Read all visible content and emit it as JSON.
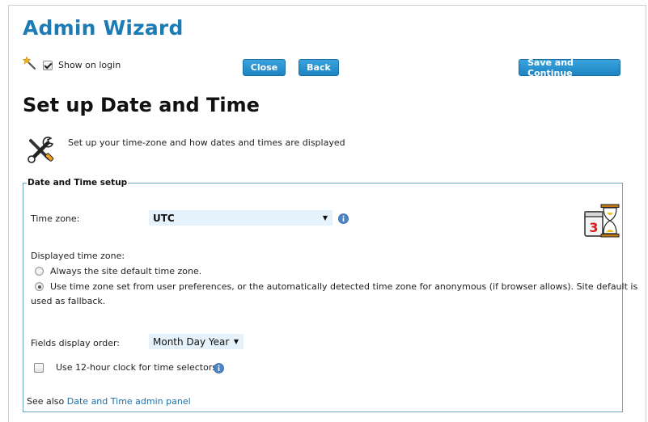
{
  "header": {
    "title": "Admin Wizard",
    "show_on_login_label": "Show on login",
    "show_on_login_checked": true,
    "close_label": "Close",
    "back_label": "Back",
    "save_continue_label": "Save and Continue"
  },
  "page": {
    "title": "Set up Date and Time",
    "description": "Set up your time-zone and how dates and times are displayed"
  },
  "fieldset": {
    "legend": "Date and Time setup",
    "timezone_label": "Time zone:",
    "timezone_value": "UTC",
    "displayed_tz_label": "Displayed time zone:",
    "radio_options": [
      {
        "label": "Always the site default time zone.",
        "selected": false
      },
      {
        "label": "Use time zone set from user preferences, or the automatically detected time zone for anonymous (if browser allows). Site default is",
        "selected": true
      }
    ],
    "radio_option_2_cont": "used as fallback.",
    "fields_order_label": "Fields display order:",
    "fields_order_value": "Month Day Year",
    "clock_label": "Use 12-hour clock for time selectors",
    "clock_checked": false,
    "see_also_prefix": "See also",
    "see_also_link": "Date and Time admin panel",
    "calendar_day": "3"
  },
  "icons": {
    "wand": "magic-wand-icon",
    "tools": "wrench-screwdriver-icon",
    "info": "info-icon",
    "calendar": "calendar-hourglass-icon"
  },
  "colors": {
    "accent": "#1c7bb4",
    "button": "#2a92cf",
    "link": "#1c6fa8",
    "fieldset_border": "#6aa6c8",
    "select_bg": "#e6f2fb"
  }
}
